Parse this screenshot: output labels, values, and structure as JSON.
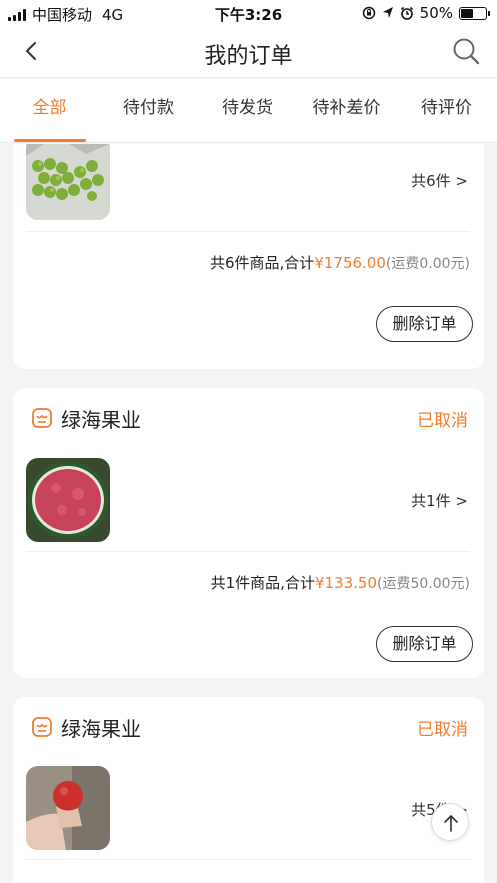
{
  "status_bar": {
    "carrier": "中国移动",
    "network": "4G",
    "time": "下午3:26",
    "battery": "50%",
    "battery_level": 0.5
  },
  "nav": {
    "title": "我的订单",
    "back_icon": "chevron-left-icon",
    "search_icon": "search-icon"
  },
  "tabs": [
    {
      "label": "全部",
      "active": true
    },
    {
      "label": "待付款",
      "active": false
    },
    {
      "label": "待发货",
      "active": false
    },
    {
      "label": "待补差价",
      "active": false
    },
    {
      "label": "待评价",
      "active": false
    }
  ],
  "colors": {
    "accent": "#ef7d2e",
    "background": "#f4f4f6"
  },
  "orders": [
    {
      "shop_name": "",
      "status": "",
      "item_count_label": "共6件 >",
      "summary_prefix": "共6件商品,合计",
      "total": "¥1756.00",
      "freight": "(运费0.00元)",
      "action": "删除订单"
    },
    {
      "shop_name": "绿海果业",
      "status": "已取消",
      "item_count_label": "共1件 >",
      "summary_prefix": "共1件商品,合计",
      "total": "¥133.50",
      "freight": "(运费50.00元)",
      "action": "删除订单"
    },
    {
      "shop_name": "绿海果业",
      "status": "已取消",
      "item_count_label": "共5件 >",
      "summary_prefix": "",
      "total": "",
      "freight": "",
      "action": ""
    }
  ],
  "scroll_top_icon": "arrow-up-icon"
}
